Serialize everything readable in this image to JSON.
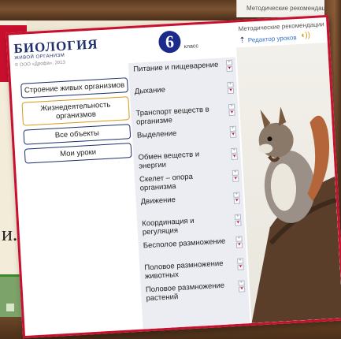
{
  "app": {
    "brand_title": "БИОЛОГИЯ",
    "brand_subtitle": "ЖИВОЙ ОРГАНИЗМ",
    "copyright": "© ООО «Дрофа», 2013",
    "grade_number": "6",
    "grade_label": "класс"
  },
  "nav": {
    "items": [
      {
        "label": "Строение живых организмов",
        "active": false
      },
      {
        "label": "Жизнедеятельность организмов",
        "active": true
      },
      {
        "label": "Все объекты",
        "active": false
      },
      {
        "label": "Мои уроки",
        "active": false
      }
    ]
  },
  "topics": [
    "Питание и пищеварение",
    "Дыхание",
    "Транспорт веществ в организме",
    "Выделение",
    "Обмен веществ и энергии",
    "Скелет – опора организма",
    "Движение",
    "Координация и регуляция",
    "Бесполое размножение",
    "Половое размножение животных",
    "Половое размножение растений"
  ],
  "toolbar": {
    "method_label": "Методические рекомендации",
    "editor_label": "Редактор уроков",
    "up_icon": "arrow-up-icon",
    "speaker_icon": "speaker-icon"
  },
  "background": {
    "fragment_text": "и."
  },
  "colors": {
    "frame_red": "#c8102e",
    "brand_navy": "#1e2f6b",
    "grade_blue": "#1c2a8c",
    "active_border": "#d69a1b",
    "link_blue": "#3a73c8"
  }
}
